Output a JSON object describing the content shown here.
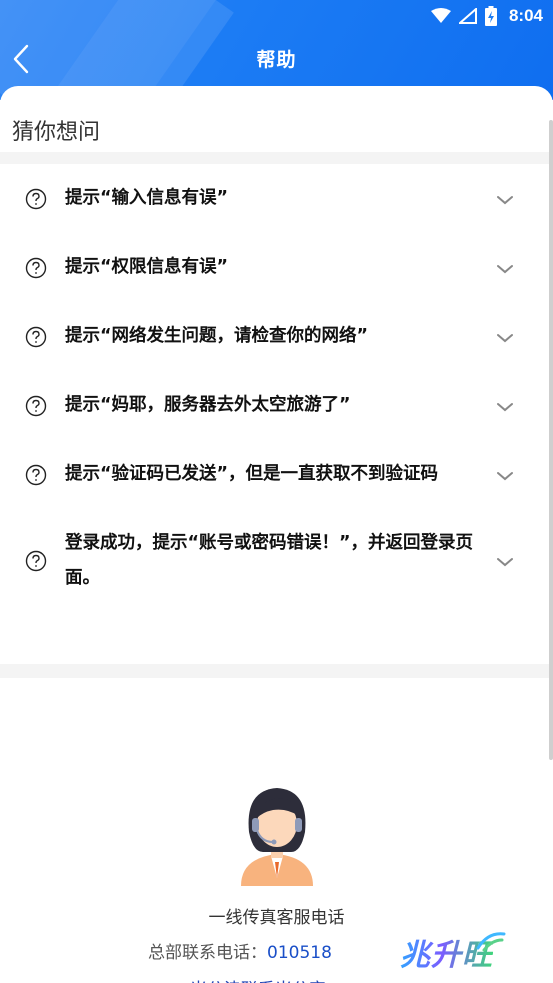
{
  "status_bar": {
    "time": "8:04"
  },
  "header": {
    "title": "帮助"
  },
  "section": {
    "title": "猜你想问"
  },
  "faq": [
    {
      "text": "提示“输入信息有误”"
    },
    {
      "text": "提示“权限信息有误”"
    },
    {
      "text": "提示“网络发生问题，请检查你的网络”"
    },
    {
      "text": "提示“妈耶，服务器去外太空旅游了”"
    },
    {
      "text": "提示“验证码已发送”，但是一直获取不到验证码"
    },
    {
      "text": "登录成功，提示“账号或密码错误！”，并返回登录页面。"
    }
  ],
  "contact": {
    "hotline_label": "一线传真客服电话",
    "hq_label": "总部联系电话：",
    "hq_number": "010518",
    "cut_text": "米公津联系米公字"
  },
  "watermark": {
    "text": "兆升旺"
  },
  "colors": {
    "header": "#1c7cf4",
    "accent_link": "#1a4fc8"
  }
}
